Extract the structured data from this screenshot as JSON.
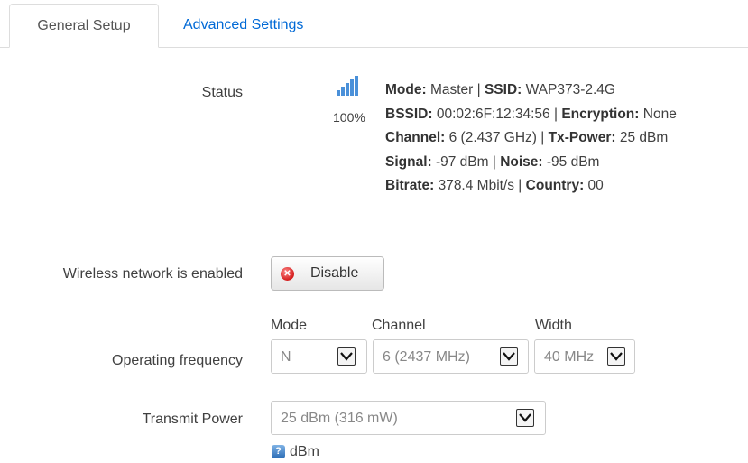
{
  "tabs": [
    {
      "label": "General Setup",
      "active": true
    },
    {
      "label": "Advanced Settings",
      "active": false
    }
  ],
  "status": {
    "label": "Status",
    "icon": "signal-strength-icon",
    "percent": "100%",
    "mode_key": "Mode:",
    "mode_val": " Master | ",
    "ssid_key": "SSID:",
    "ssid_val": " WAP373-2.4G",
    "bssid_key": "BSSID:",
    "bssid_val": " 00:02:6F:12:34:56 | ",
    "enc_key": "Encryption:",
    "enc_val": " None",
    "channel_key": "Channel:",
    "channel_val": " 6 (2.437 GHz) | ",
    "txp_key": "Tx-Power:",
    "txp_val": " 25 dBm",
    "signal_key": "Signal:",
    "signal_val": " -97 dBm | ",
    "noise_key": "Noise:",
    "noise_val": " -95 dBm",
    "bitrate_key": "Bitrate:",
    "bitrate_val": " 378.4 Mbit/s | ",
    "country_key": "Country:",
    "country_val": " 00"
  },
  "wireless": {
    "label": "Wireless network is enabled",
    "button_label": "Disable",
    "button_icon": "close-icon"
  },
  "frequency": {
    "label": "Operating frequency",
    "mode_label": "Mode",
    "mode_value": "N",
    "channel_label": "Channel",
    "channel_value": "6 (2437 MHz)",
    "width_label": "Width",
    "width_value": "40 MHz"
  },
  "transmit": {
    "label": "Transmit Power",
    "value": "25 dBm (316 mW)",
    "help_icon": "help-icon",
    "help_text": "dBm"
  },
  "colors": {
    "link": "#0069d6",
    "signal": "#4a90d9",
    "disable_icon": "#d41d1d"
  }
}
